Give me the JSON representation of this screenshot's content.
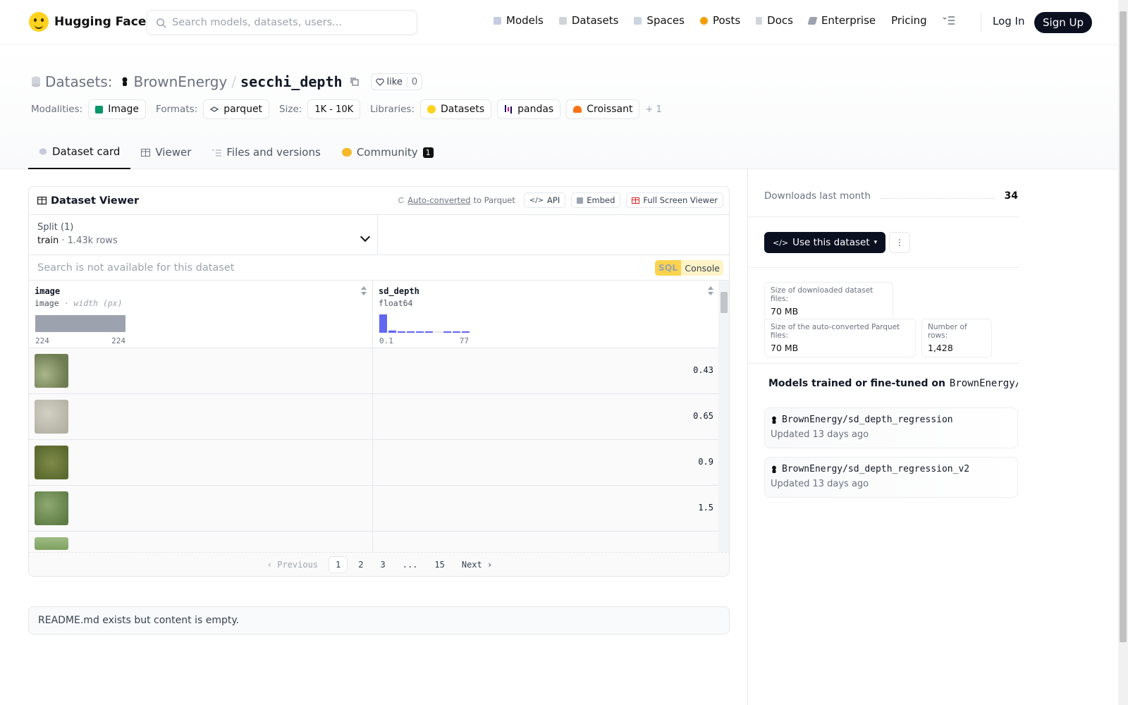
{
  "nav": {
    "brand": "Hugging Face",
    "search_placeholder": "Search models, datasets, users...",
    "links": [
      "Models",
      "Datasets",
      "Spaces",
      "Posts",
      "Docs",
      "Enterprise",
      "Pricing"
    ],
    "login": "Log In",
    "signup": "Sign Up"
  },
  "header": {
    "section": "Datasets:",
    "owner": "BrownEnergy",
    "sep": "/",
    "name": "secchi_depth",
    "like_label": "like",
    "like_count": "0",
    "modalities_label": "Modalities:",
    "modality": "Image",
    "formats_label": "Formats:",
    "format": "parquet",
    "size_label": "Size:",
    "size": "1K - 10K",
    "libraries_label": "Libraries:",
    "libraries": [
      "Datasets",
      "pandas",
      "Croissant"
    ],
    "more_libraries": "+ 1"
  },
  "tabs": {
    "card": "Dataset card",
    "viewer": "Viewer",
    "files": "Files and versions",
    "community": "Community",
    "community_count": "1"
  },
  "viewer": {
    "title": "Dataset Viewer",
    "autoconv_link": "Auto-converted",
    "autoconv_rest": "to Parquet",
    "api": "API",
    "embed": "Embed",
    "fullscreen": "Full Screen Viewer",
    "split_label": "Split (1)",
    "split_name": "train",
    "split_dot": "·",
    "split_rows": "1.43k rows",
    "search_disabled": "Search is not available for this dataset",
    "sql": "SQL",
    "console": "Console",
    "col1": {
      "name": "image",
      "type": "image",
      "subtype": "· width (px)",
      "min": "224",
      "max": "224"
    },
    "col2": {
      "name": "sd_depth",
      "type": "float64",
      "min": "0.1",
      "max": "77"
    },
    "rows": [
      "0.43",
      "0.65",
      "0.9",
      "1.5"
    ],
    "pager": {
      "prev": "Previous",
      "pages": [
        "1",
        "2",
        "3",
        "...",
        "15"
      ],
      "next": "Next"
    }
  },
  "chart_data": {
    "type": "bar",
    "title": "",
    "categories": [
      "b1",
      "b2",
      "b3",
      "b4",
      "b5",
      "b6",
      "b7",
      "b8",
      "b9",
      "b10"
    ],
    "values": [
      1050,
      130,
      40,
      30,
      25,
      20,
      0,
      10,
      5,
      5
    ],
    "xlim": [
      0.1,
      77
    ]
  },
  "readme": "README.md exists but content is empty.",
  "sidebar": {
    "downloads_label": "Downloads last month",
    "downloads": "34",
    "use_dataset": "Use this dataset",
    "dl_size_label": "Size of downloaded dataset files:",
    "dl_size": "70 MB",
    "pq_size_label": "Size of the auto-converted Parquet files:",
    "pq_size": "70 MB",
    "rows_label": "Number of rows:",
    "rows": "1,428",
    "models_title": "Models trained or fine-tuned on",
    "models_target": "BrownEnergy/secchi_depth",
    "models": [
      {
        "name": "BrownEnergy/sd_depth_regression",
        "updated": "Updated 13 days ago"
      },
      {
        "name": "BrownEnergy/sd_depth_regression_v2",
        "updated": "Updated 13 days ago"
      }
    ]
  }
}
